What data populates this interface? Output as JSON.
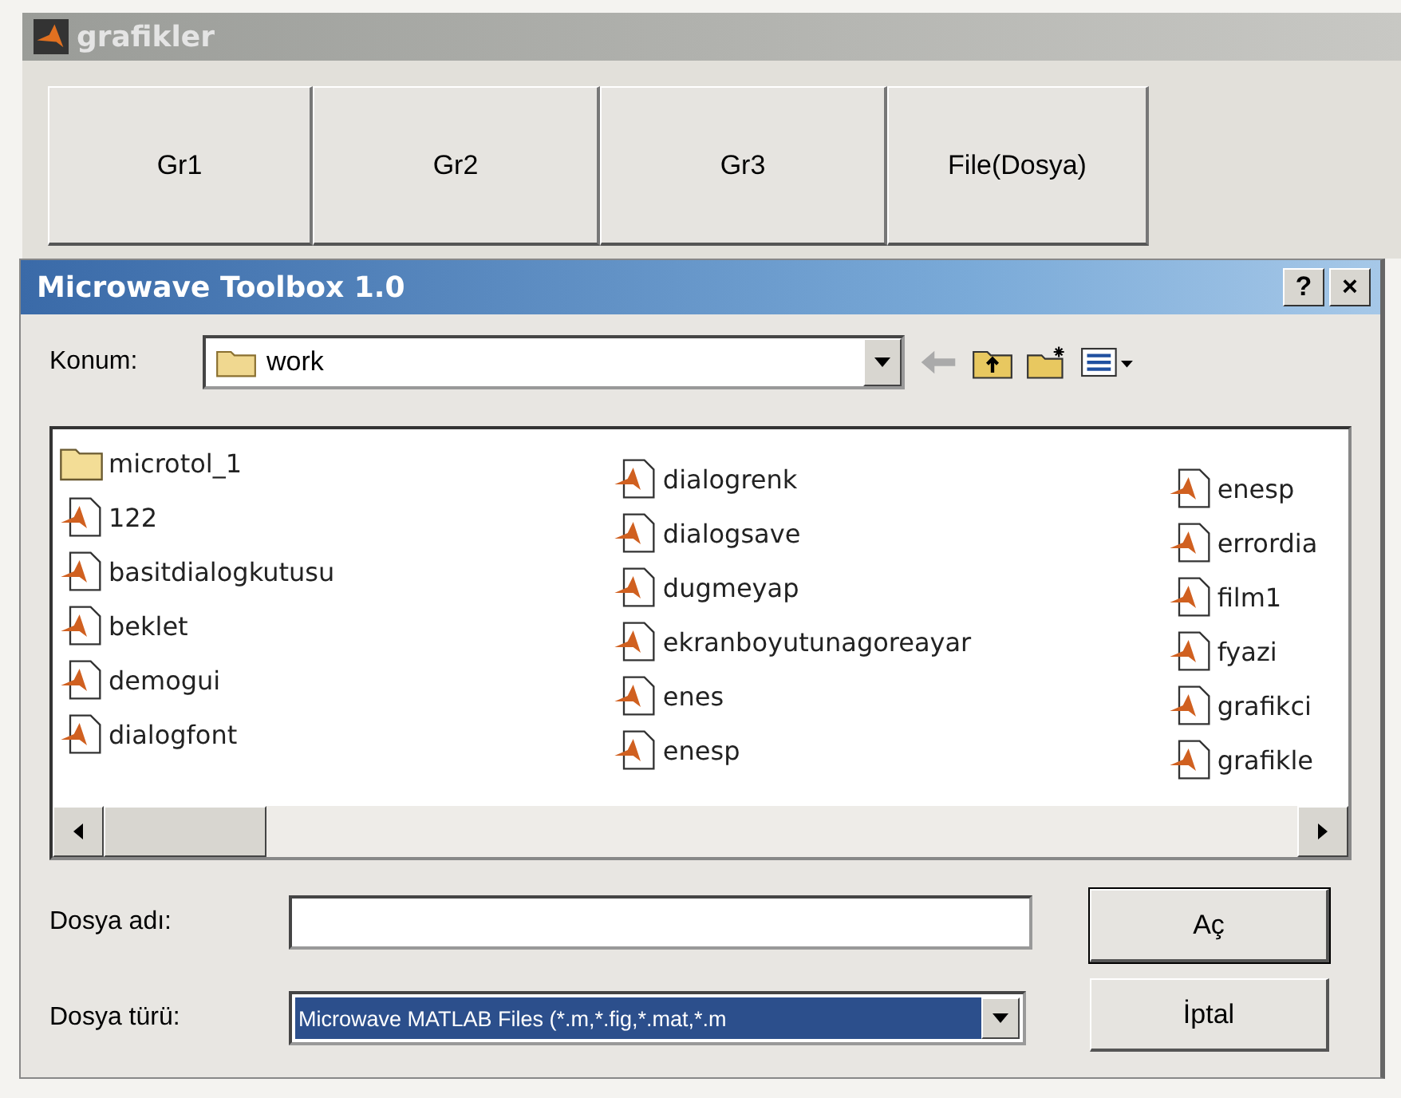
{
  "window": {
    "title": "grafikler"
  },
  "buttons": [
    "Gr1",
    "Gr2",
    "Gr3",
    "File(Dosya)"
  ],
  "dialog": {
    "title": "Microwave Toolbox 1.0",
    "help": "?",
    "close": "×",
    "location": {
      "label": "Konum:",
      "value": "work"
    },
    "columns": [
      [
        {
          "name": "microtol_1",
          "kind": "folder"
        },
        {
          "name": "122",
          "kind": "mfile"
        },
        {
          "name": "basitdialogkutusu",
          "kind": "mfile"
        },
        {
          "name": "beklet",
          "kind": "mfile"
        },
        {
          "name": "demogui",
          "kind": "mfile"
        },
        {
          "name": "dialogfont",
          "kind": "mfile"
        }
      ],
      [
        {
          "name": "dialogrenk",
          "kind": "mfile"
        },
        {
          "name": "dialogsave",
          "kind": "mfile"
        },
        {
          "name": "dugmeyap",
          "kind": "mfile"
        },
        {
          "name": "ekranboyutunagoreayar",
          "kind": "mfile"
        },
        {
          "name": "enes",
          "kind": "mfile"
        },
        {
          "name": "enesp",
          "kind": "mfile"
        }
      ],
      [
        {
          "name": "enesp",
          "kind": "mfile"
        },
        {
          "name": "errordia",
          "kind": "mfile"
        },
        {
          "name": "film1",
          "kind": "mfile"
        },
        {
          "name": "fyazi",
          "kind": "mfile"
        },
        {
          "name": "grafikci",
          "kind": "mfile"
        },
        {
          "name": "grafikle",
          "kind": "mfile"
        }
      ]
    ],
    "filename": {
      "label": "Dosya adı:"
    },
    "filetype": {
      "label": "Dosya türü:",
      "value": "Microwave MATLAB Files (*.m,*.fig,*.mat,*.m"
    },
    "actions": [
      "Aç",
      "İptal"
    ]
  }
}
